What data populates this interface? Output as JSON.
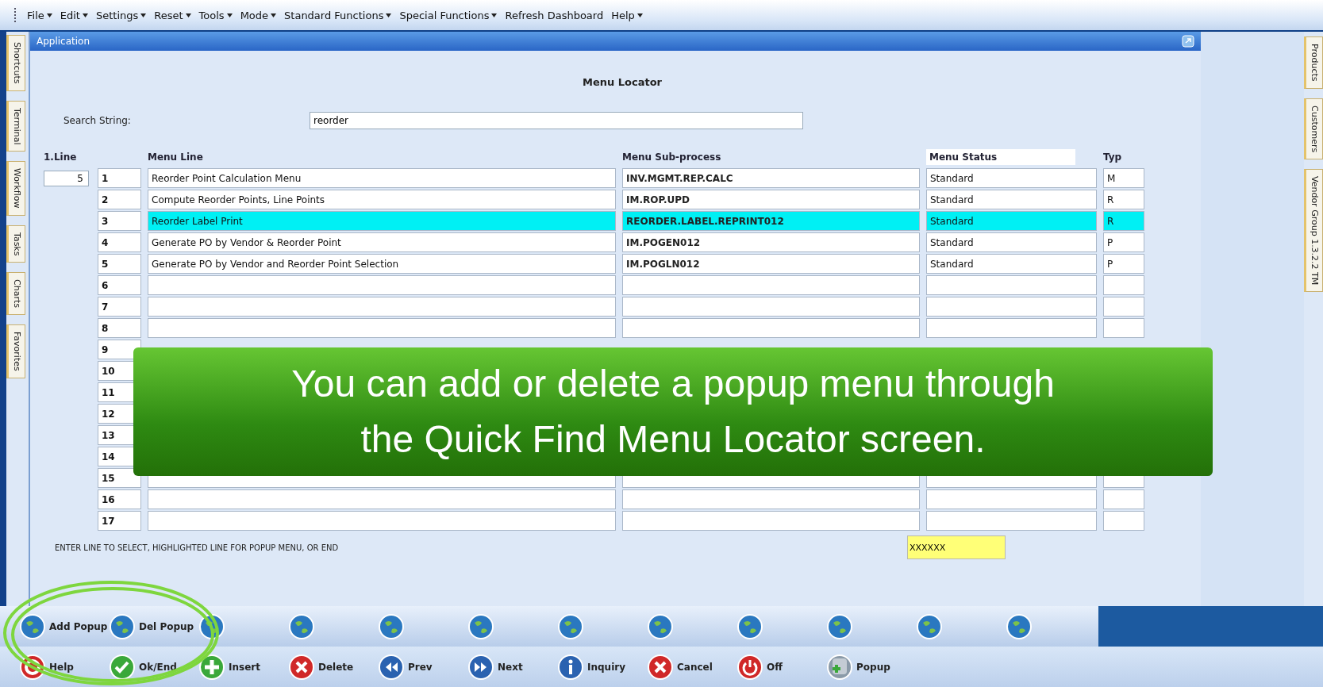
{
  "menu_bar": [
    {
      "label": "File",
      "dropdown": true
    },
    {
      "label": "Edit",
      "dropdown": true
    },
    {
      "label": "Settings",
      "dropdown": true
    },
    {
      "label": "Reset",
      "dropdown": true
    },
    {
      "label": "Tools",
      "dropdown": true
    },
    {
      "label": "Mode",
      "dropdown": true
    },
    {
      "label": "Standard Functions",
      "dropdown": true
    },
    {
      "label": "Special Functions",
      "dropdown": true
    },
    {
      "label": "Refresh Dashboard",
      "dropdown": false
    },
    {
      "label": "Help",
      "dropdown": true
    }
  ],
  "left_tabs": [
    {
      "label": "Shortcuts"
    },
    {
      "label": "Terminal"
    },
    {
      "label": "Workflow"
    },
    {
      "label": "Tasks"
    },
    {
      "label": "Charts"
    },
    {
      "label": "Favorites"
    }
  ],
  "right_tabs": [
    {
      "label": "Products"
    },
    {
      "label": "Customers"
    },
    {
      "label": "Vendor Group 1.3.2.2 TM"
    }
  ],
  "window": {
    "title": "Application",
    "heading": "Menu Locator"
  },
  "search": {
    "label": "Search String:",
    "value": "reorder"
  },
  "table": {
    "columns": [
      "1.Line",
      "Menu Line",
      "Menu Sub-process",
      "Menu Status",
      "Typ"
    ],
    "line_value": "5",
    "rows": [
      {
        "number": "1",
        "menu_line": "Reorder Point Calculation Menu",
        "sub_process": "INV.MGMT.REP.CALC",
        "status": "Standard",
        "typ": "M",
        "selected": false
      },
      {
        "number": "2",
        "menu_line": "Compute Reorder Points, Line Points",
        "sub_process": "IM.ROP.UPD",
        "status": "Standard",
        "typ": "R",
        "selected": false
      },
      {
        "number": "3",
        "menu_line": "Reorder Label Print",
        "sub_process": "REORDER.LABEL.REPRINT012",
        "status": "Standard",
        "typ": "R",
        "selected": true
      },
      {
        "number": "4",
        "menu_line": "Generate PO by Vendor & Reorder Point",
        "sub_process": "IM.POGEN012",
        "status": "Standard",
        "typ": "P",
        "selected": false
      },
      {
        "number": "5",
        "menu_line": "Generate PO by Vendor and Reorder Point Selection",
        "sub_process": "IM.POGLN012",
        "status": "Standard",
        "typ": "P",
        "selected": false
      },
      {
        "number": "6",
        "selected": false
      },
      {
        "number": "7",
        "selected": false
      },
      {
        "number": "8",
        "selected": false
      },
      {
        "number": "9"
      },
      {
        "number": "10"
      },
      {
        "number": "11"
      },
      {
        "number": "12"
      },
      {
        "number": "13"
      },
      {
        "number": "14"
      },
      {
        "number": "15",
        "selected": false
      },
      {
        "number": "16",
        "selected": false
      },
      {
        "number": "17",
        "selected": false
      }
    ]
  },
  "prompt": "ENTER LINE TO SELECT, HIGHLIGHTED LINE FOR POPUP MENU, OR END",
  "prompt_field": {
    "value": "XXXXXX"
  },
  "callout": {
    "text": "You can add or delete a popup menu through the Quick Find Menu Locator screen."
  },
  "button_rows": [
    [
      {
        "kind": "globe",
        "label": "Add Popup"
      },
      {
        "kind": "globe",
        "label": "Del Popup"
      },
      {
        "kind": "globe"
      },
      {
        "kind": "globe"
      },
      {
        "kind": "globe"
      },
      {
        "kind": "globe"
      },
      {
        "kind": "globe"
      },
      {
        "kind": "globe"
      },
      {
        "kind": "globe"
      },
      {
        "kind": "globe"
      },
      {
        "kind": "globe"
      },
      {
        "kind": "globe"
      }
    ],
    [
      {
        "kind": "help",
        "label": "Help"
      },
      {
        "kind": "ok",
        "label": "Ok/End"
      },
      {
        "kind": "insert",
        "label": "Insert"
      },
      {
        "kind": "delete",
        "label": "Delete"
      },
      {
        "kind": "prev",
        "label": "Prev"
      },
      {
        "kind": "next",
        "label": "Next"
      },
      {
        "kind": "info",
        "label": "Inquiry"
      },
      {
        "kind": "cancel",
        "label": "Cancel"
      },
      {
        "kind": "off",
        "label": "Off"
      },
      {
        "kind": "popup",
        "label": "Popup"
      }
    ]
  ]
}
